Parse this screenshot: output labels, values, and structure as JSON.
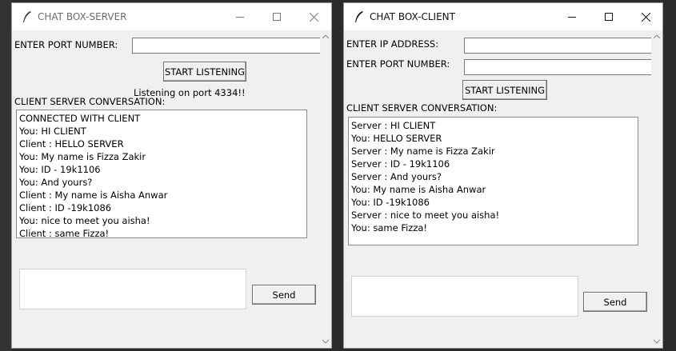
{
  "server": {
    "title": "CHAT BOX-SERVER",
    "port_label": "ENTER PORT NUMBER:",
    "port_value": "",
    "start_button": "START LISTENING",
    "status": "Listening on port 4334!!",
    "conversation_label": "CLIENT SERVER CONVERSATION:",
    "messages": [
      "CONNECTED WITH CLIENT",
      "You: HI CLIENT",
      "Client :  HELLO SERVER",
      "You: My name is Fizza Zakir",
      "You: ID - 19k1106",
      "You: And yours?",
      "Client :  My name is Aisha Anwar",
      "Client :  ID -19k1086",
      "You: nice to meet you aisha!",
      "Client :  same Fizza!"
    ],
    "message_input": "",
    "send_button": "Send"
  },
  "client": {
    "title": "CHAT BOX-CLIENT",
    "ip_label": "ENTER IP ADDRESS:",
    "ip_value": "",
    "port_label": "ENTER PORT NUMBER:",
    "port_value": "",
    "start_button": "START LISTENING",
    "conversation_label": "CLIENT SERVER CONVERSATION:",
    "messages": [
      "Server :  HI CLIENT",
      "You: HELLO SERVER",
      "Server :  My name is Fizza Zakir",
      "Server :  ID - 19k1106",
      "Server :  And yours?",
      "You: My name is Aisha Anwar",
      "You: ID -19k1086",
      "Server :  nice to meet you aisha!",
      "You: same Fizza!"
    ],
    "message_input": "",
    "send_button": "Send"
  },
  "window_controls": {
    "minimize_icon": "minimize-icon",
    "maximize_icon": "maximize-icon",
    "close_icon": "close-icon"
  },
  "colors": {
    "window_bg": "#f0f0f0",
    "titlebar_bg": "#ffffff",
    "desktop_bg": "#2b2b2b"
  }
}
